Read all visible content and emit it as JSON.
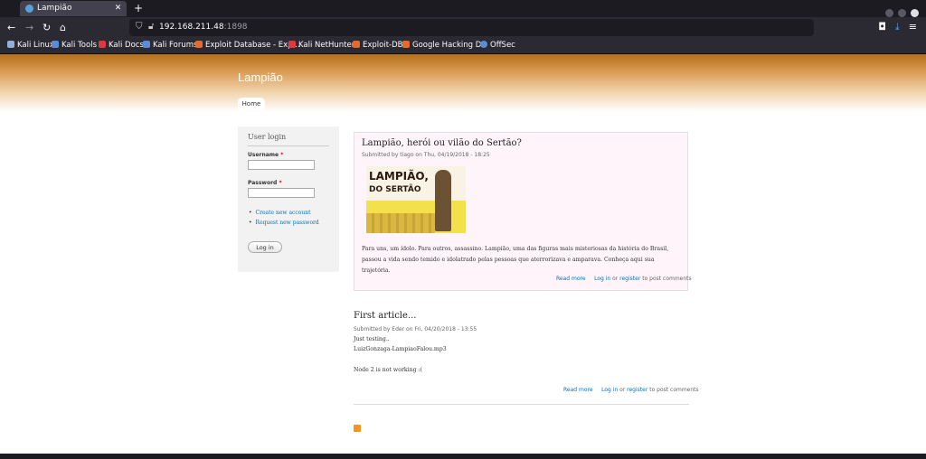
{
  "browser": {
    "tab_title": "Lampião",
    "tab_close": "✕",
    "new_tab": "+",
    "url_host": "192.168.211.48",
    "url_port": ":1898",
    "bookmarks": [
      {
        "label": "Kali Linux",
        "color": "#8fb0d8"
      },
      {
        "label": "Kali Tools",
        "color": "#5b8dd6"
      },
      {
        "label": "Kali Docs",
        "color": "#e0383e"
      },
      {
        "label": "Kali Forums",
        "color": "#5b8dd6"
      },
      {
        "label": "Exploit Database - Exp...",
        "color": "#e66a2c"
      },
      {
        "label": "Kali NetHunter",
        "color": "#e0383e"
      },
      {
        "label": "Exploit-DB",
        "color": "#e66a2c"
      },
      {
        "label": "Google Hacking DB",
        "color": "#e66a2c"
      },
      {
        "label": "OffSec",
        "color": "#5b8dd6"
      }
    ]
  },
  "site": {
    "name": "Lampião",
    "home_tab": "Home"
  },
  "login": {
    "title": "User login",
    "username_label": "Username",
    "password_label": "Password",
    "required": "*",
    "create_account": "Create new account",
    "request_password": "Request new password",
    "button": "Log in"
  },
  "node1": {
    "title": "Lampião, herói ou vilão do Sertão?",
    "submitted": "Submitted by tiago on Thu, 04/19/2018 - 18:25",
    "image_text_1": "LAMPIÃO,",
    "image_text_2": "DO SERTÃO",
    "body": "Para uns, um ídolo. Para outros, assassino. Lampião, uma das figuras mais misteriosas da história do Brasil, passou a vida sendo temido e idolatrado pelas pessoas que aterrorizava e amparava. Conheça aqui sua trajetória.",
    "read_more": "Read more",
    "log_in": "Log in",
    "or": "or",
    "register": "register",
    "to_post": "to post comments"
  },
  "node2": {
    "title": "First article...",
    "submitted": "Submitted by Eder on Fri, 04/20/2018 - 13:55",
    "line1": "Just testing..",
    "line2": "LuizGonzaga-LampiaoFalou.mp3",
    "line3": "Node 2 is not working :(",
    "read_more": "Read more",
    "log_in": "Log in",
    "or": "or",
    "register": "register",
    "to_post": "to post comments"
  },
  "colors": {
    "link": "#0071b3",
    "header_brown": "#b36f1c"
  }
}
